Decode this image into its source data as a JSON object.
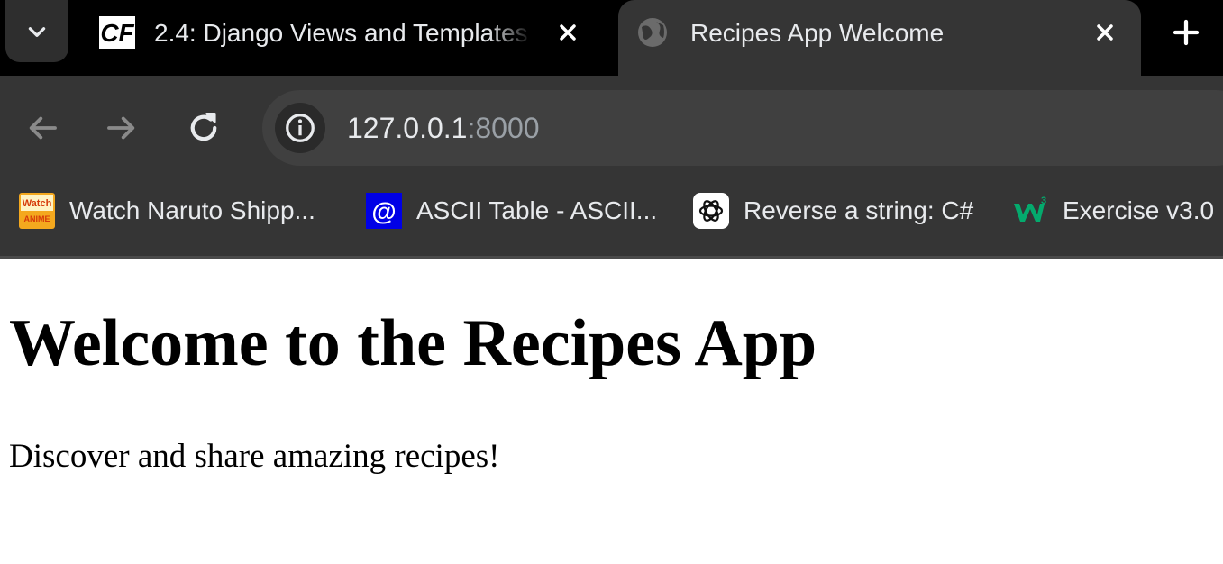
{
  "tabs": [
    {
      "title": "2.4: Django Views and Templates",
      "favicon": "cf-logo-icon",
      "active": false
    },
    {
      "title": "Recipes App Welcome",
      "favicon": "globe-icon",
      "active": true
    }
  ],
  "toolbar": {
    "url_host": "127.0.0.1",
    "url_port": ":8000"
  },
  "bookmarks": [
    {
      "label": "Watch Naruto Shipp...",
      "icon": "watch-anime-icon"
    },
    {
      "label": "ASCII Table - ASCII...",
      "icon": "at-sign-icon"
    },
    {
      "label": "Reverse a string: C#",
      "icon": "openai-icon"
    },
    {
      "label": "Exercise v3.0",
      "icon": "w3schools-icon"
    }
  ],
  "favicon_texts": {
    "cf": "CF",
    "watch_top": "Watch",
    "watch_bottom": "ANIME",
    "at": "@",
    "w3_sup": "3"
  },
  "page": {
    "heading": "Welcome to the Recipes App",
    "paragraph": "Discover and share amazing recipes!"
  },
  "colors": {
    "tabstrip_bg": "#000000",
    "toolbar_bg": "#353535",
    "omnibox_bg": "#404040",
    "text_light": "#e8eaed",
    "text_muted": "#9aa0a6"
  }
}
